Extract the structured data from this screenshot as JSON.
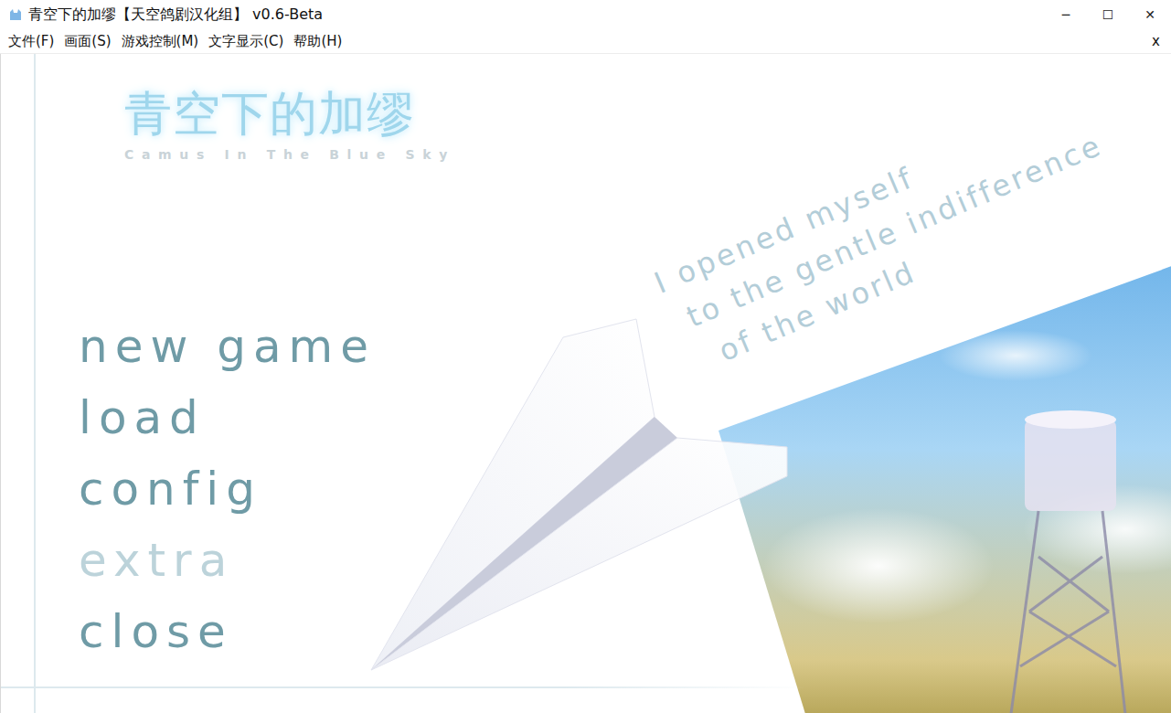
{
  "window": {
    "title": "青空下的加缪【天空鸽剧汉化组】 v0.6-Beta",
    "controls": [
      "─",
      "☐",
      "✕"
    ]
  },
  "menu_bar": {
    "items": [
      "文件(F)",
      "画面(S)",
      "游戏控制(M)",
      "文字显示(C)",
      "帮助(H)"
    ],
    "close": "x"
  },
  "logo": {
    "title": "青空下的加缪",
    "subtitle": "Camus In The Blue Sky"
  },
  "title_menu": [
    {
      "label": "new game",
      "disabled": false
    },
    {
      "label": "load",
      "disabled": false
    },
    {
      "label": "config",
      "disabled": false
    },
    {
      "label": "extra",
      "disabled": true
    },
    {
      "label": "close",
      "disabled": false
    }
  ],
  "quote": [
    "I opened myself",
    "to the gentle indifference",
    "of the world"
  ]
}
